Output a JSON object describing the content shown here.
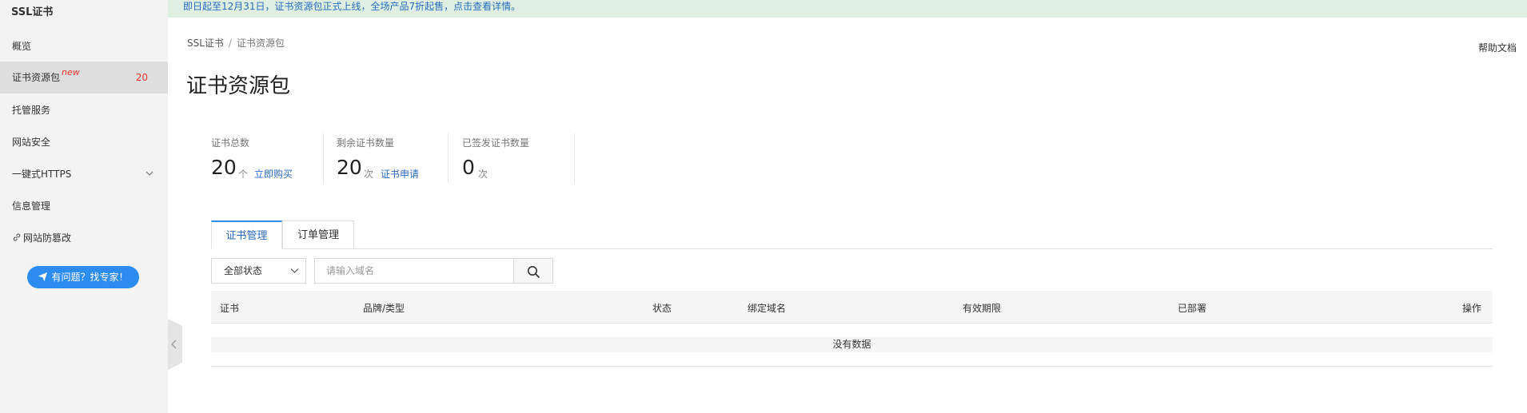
{
  "notice": {
    "text": "即日起至12月31日，证书资源包正式上线，全场产品7折起售，点击查看详情。"
  },
  "sidebar": {
    "title": "SSL证书",
    "items": [
      {
        "label": "概览"
      },
      {
        "label": "证书资源包",
        "badge": "new",
        "count": "20"
      },
      {
        "label": "托管服务"
      },
      {
        "label": "网站安全"
      },
      {
        "label": "一键式HTTPS"
      },
      {
        "label": "信息管理"
      },
      {
        "label": "网站防篡改"
      }
    ],
    "help_button": "有问题？找专家！"
  },
  "breadcrumb": {
    "root": "SSL证书",
    "separator": "/",
    "current": "证书资源包"
  },
  "help_doc": "帮助文档",
  "page_title": "证书资源包",
  "stats": [
    {
      "label": "证书总数",
      "value": "20",
      "unit": "个",
      "action": "立即购买"
    },
    {
      "label": "剩余证书数量",
      "value": "20",
      "unit": "次",
      "action": "证书申请"
    },
    {
      "label": "已签发证书数量",
      "value": "0",
      "unit": "次"
    }
  ],
  "tabs": [
    {
      "label": "证书管理"
    },
    {
      "label": "订单管理"
    }
  ],
  "filter": {
    "status_selected": "全部状态",
    "search_placeholder": "请输入域名"
  },
  "table": {
    "columns": [
      "证书",
      "品牌/类型",
      "状态",
      "绑定域名",
      "有效期限",
      "已部署",
      "操作"
    ],
    "empty_text": "没有数据"
  },
  "colors": {
    "accent": "#2d8cf0",
    "link": "#2d6bbf",
    "notice_bg": "#dff0e3",
    "count_red": "#e33"
  }
}
